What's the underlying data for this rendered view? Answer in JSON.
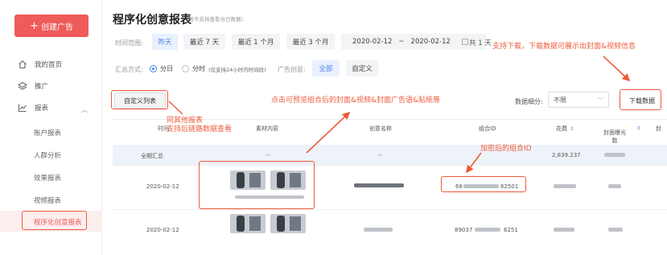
{
  "sidebar": {
    "create_label": "创建广告",
    "home": "我的首页",
    "promo": "推广",
    "reports": "报表",
    "sub_items": [
      "账户报表",
      "人群分析",
      "效果报表",
      "视频报表",
      "程序化创意报表"
    ]
  },
  "header": {
    "title": "程序化创意报表",
    "note": "(暂不支持查看当日数据)"
  },
  "filters": {
    "time_label": "时间范围:",
    "time_chips": [
      "昨天",
      "最近 7 天",
      "最近 1 个月",
      "最近 3 个月"
    ],
    "date_start": "2020-02-12",
    "date_sep": "~",
    "date_end": "2020-02-12",
    "days": "共 1 天",
    "summary_label": "汇总方式:",
    "radio_day": "分日",
    "radio_hour": "分时",
    "radio_hour_note": "(仅支持24小时内时间段)",
    "creative_label": "广告创意:",
    "creative_all": "全部",
    "creative_custom": "自定义"
  },
  "toolbar": {
    "custom_cols": "自定义列表",
    "seg_label": "数据细分:",
    "seg_value": "不限",
    "download": "下载数据"
  },
  "table": {
    "headers": [
      "时间",
      "素材内容",
      "创意名称",
      "组合ID",
      "花费",
      "封面曝光\n数",
      "封"
    ],
    "summary": {
      "label": "全期汇总",
      "material": "--",
      "name": "--",
      "cost": "2,839.237"
    },
    "rows": [
      {
        "date": "2020-02-12",
        "combo_id_prefix": "68",
        "combo_id_suffix": "62501"
      },
      {
        "date": "2020-02-12",
        "combo_id_prefix": "89037",
        "combo_id_suffix": "6251"
      }
    ]
  },
  "annotations": {
    "download_tip": "支持下载，下载数据可展示出封面&视频信息",
    "preview_tip": "点击可预览组合后的封面&视频&封面广告语&贴纸等",
    "same_report_1": "同其他报表",
    "same_report_2": "支持后链路数据查看",
    "encrypted_id": "加密后的组合ID"
  },
  "colors": {
    "accent_red": "#ef5a5a",
    "annotation": "#ee5b3b",
    "link_blue": "#4a84e8"
  }
}
